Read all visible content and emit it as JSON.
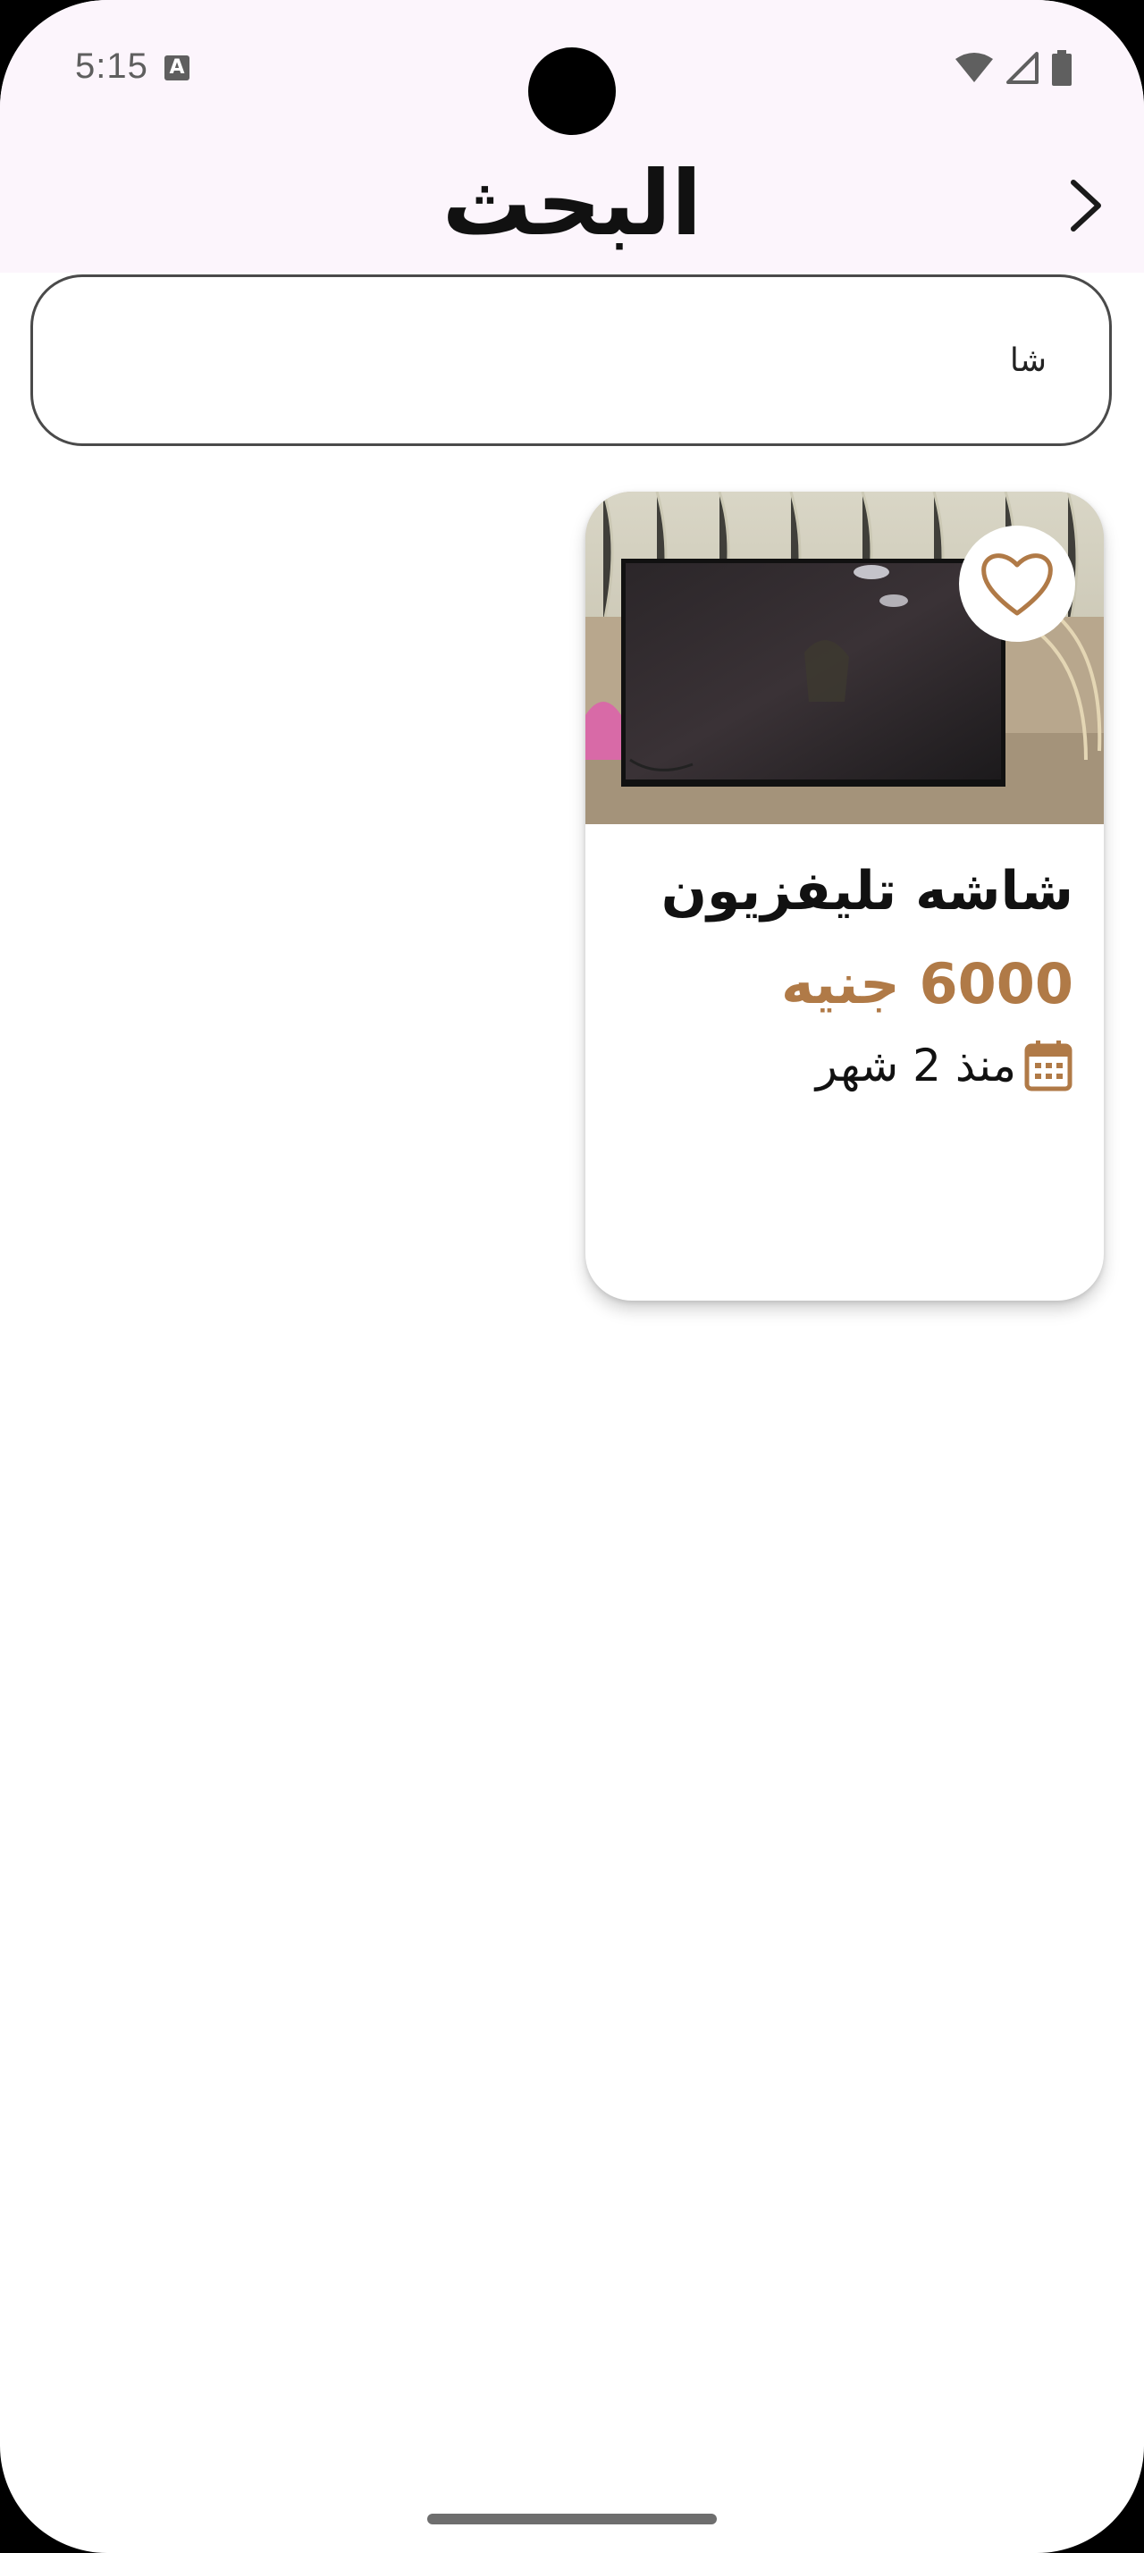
{
  "status_bar": {
    "time": "5:15",
    "notification_icon_letter": "A",
    "icons": [
      "wifi-icon",
      "cell-signal-icon",
      "battery-icon"
    ]
  },
  "app_bar": {
    "title": "البحث",
    "back_icon": "chevron-icon"
  },
  "search": {
    "value": "شا"
  },
  "results": [
    {
      "title": "شاشه تليفزيون",
      "price": "6000 جنيه",
      "date": "منذ 2 شهر",
      "favorite_icon": "heart-outline-icon",
      "date_icon": "calendar-icon"
    }
  ],
  "colors": {
    "accent": "#b07a47",
    "topbar_bg": "#fcf5fc",
    "text": "#111111"
  }
}
